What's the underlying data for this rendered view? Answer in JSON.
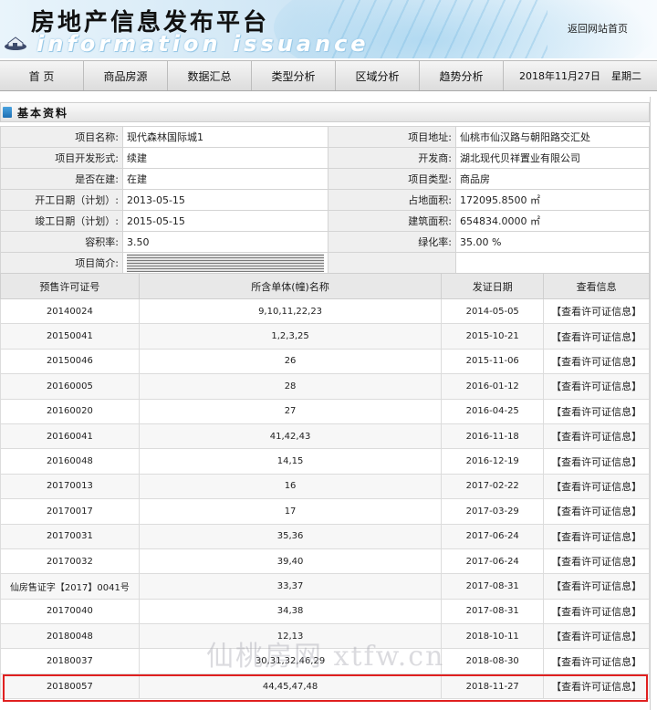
{
  "header": {
    "title": "房地产信息发布平台",
    "subtitle": "information issuance",
    "home_link": "返回网站首页"
  },
  "nav": {
    "items": [
      "首 页",
      "商品房源",
      "数据汇总",
      "类型分析",
      "区域分析",
      "趋势分析"
    ],
    "date": "2018年11月27日",
    "weekday": "星期二"
  },
  "section": {
    "title": "基本资料"
  },
  "info": {
    "rows": [
      {
        "l1": "项目名称:",
        "v1": "现代森林国际城1",
        "l2": "项目地址:",
        "v2": "仙桃市仙汉路与朝阳路交汇处"
      },
      {
        "l1": "项目开发形式:",
        "v1": "续建",
        "l2": "开发商:",
        "v2": "湖北现代贝祥置业有限公司"
      },
      {
        "l1": "是否在建:",
        "v1": "在建",
        "l2": "项目类型:",
        "v2": "商品房"
      },
      {
        "l1": "开工日期（计划）:",
        "v1": "2013-05-15",
        "l2": "占地面积:",
        "v2": "172095.8500 ㎡"
      },
      {
        "l1": "竣工日期（计划）:",
        "v1": "2015-05-15",
        "l2": "建筑面积:",
        "v2": "654834.0000 ㎡"
      },
      {
        "l1": "容积率:",
        "v1": "3.50",
        "l2": "绿化率:",
        "v2": "35.00 %"
      }
    ],
    "intro_label": "项目简介:"
  },
  "permits": {
    "headers": [
      "预售许可证号",
      "所含单体(幢)名称",
      "发证日期",
      "查看信息"
    ],
    "link_text": "【查看许可证信息】",
    "rows": [
      [
        "20140024",
        "9,10,11,22,23",
        "2014-05-05"
      ],
      [
        "20150041",
        "1,2,3,25",
        "2015-10-21"
      ],
      [
        "20150046",
        "26",
        "2015-11-06"
      ],
      [
        "20160005",
        "28",
        "2016-01-12"
      ],
      [
        "20160020",
        "27",
        "2016-04-25"
      ],
      [
        "20160041",
        "41,42,43",
        "2016-11-18"
      ],
      [
        "20160048",
        "14,15",
        "2016-12-19"
      ],
      [
        "20170013",
        "16",
        "2017-02-22"
      ],
      [
        "20170017",
        "17",
        "2017-03-29"
      ],
      [
        "20170031",
        "35,36",
        "2017-06-24"
      ],
      [
        "20170032",
        "39,40",
        "2017-06-24"
      ],
      [
        "仙房售证字【2017】0041号",
        "33,37",
        "2017-08-31"
      ],
      [
        "20170040",
        "34,38",
        "2017-08-31"
      ],
      [
        "20180048",
        "12,13",
        "2018-10-11"
      ],
      [
        "20180037",
        "30,31,32,46,29",
        "2018-08-30"
      ],
      [
        "20180057",
        "44,45,47,48",
        "2018-11-27"
      ]
    ]
  },
  "watermark": "仙桃房网 xtfw.cn",
  "colors": {
    "highlight": "#e02020",
    "header_accent": "#8fc3e4"
  }
}
